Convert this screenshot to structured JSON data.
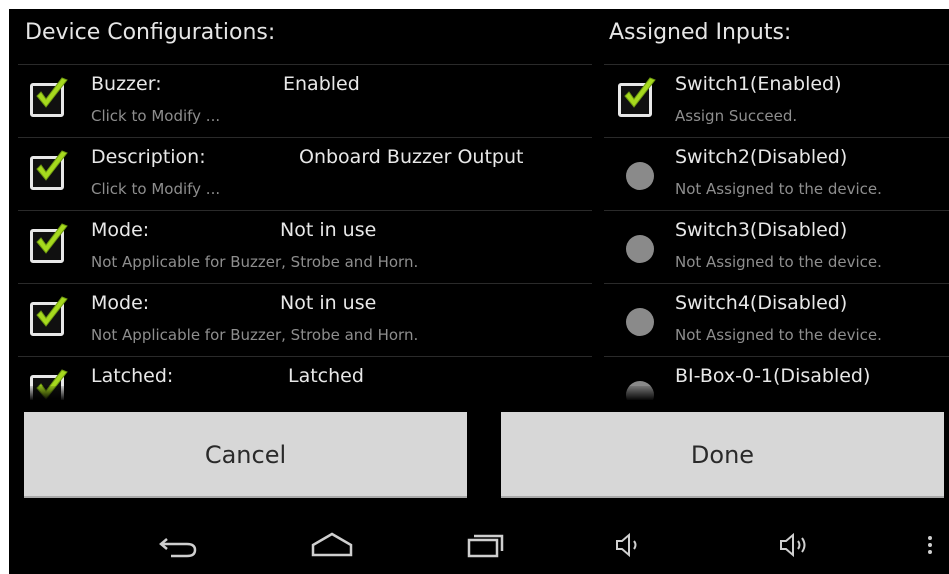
{
  "left_panel": {
    "title": "Device Configurations:",
    "rows": [
      {
        "label": "Buzzer:",
        "value": "Enabled",
        "sub": "Click to Modify ..."
      },
      {
        "label": "Description:",
        "value": "Onboard Buzzer Output",
        "sub": "Click to Modify ..."
      },
      {
        "label": "Mode:",
        "value": "Not in use",
        "sub": "Not Applicable for Buzzer, Strobe and Horn."
      },
      {
        "label": "Mode:",
        "value": "Not in use",
        "sub": "Not Applicable for Buzzer, Strobe and Horn."
      },
      {
        "label": "Latched:",
        "value": "Latched",
        "sub": ""
      }
    ]
  },
  "right_panel": {
    "title": "Assigned Inputs:",
    "rows": [
      {
        "label": "Switch1(Enabled)",
        "sub": "Assign Succeed.",
        "indicator": "checkbox"
      },
      {
        "label": "Switch2(Disabled)",
        "sub": "Not Assigned to the device.",
        "indicator": "dot"
      },
      {
        "label": "Switch3(Disabled)",
        "sub": "Not Assigned to the device.",
        "indicator": "dot"
      },
      {
        "label": "Switch4(Disabled)",
        "sub": "Not Assigned to the device.",
        "indicator": "dot"
      },
      {
        "label": "BI-Box-0-1(Disabled)",
        "sub": "",
        "indicator": "dot"
      }
    ]
  },
  "buttons": {
    "cancel": "Cancel",
    "done": "Done"
  },
  "navbar": {
    "icons": [
      "back-icon",
      "home-icon",
      "recent-apps-icon",
      "volume-down-icon",
      "volume-up-icon",
      "overflow-menu-icon"
    ]
  },
  "colors": {
    "checkmark": "#a6d91e",
    "button_bg": "#d7d7d7",
    "background": "#000000"
  }
}
